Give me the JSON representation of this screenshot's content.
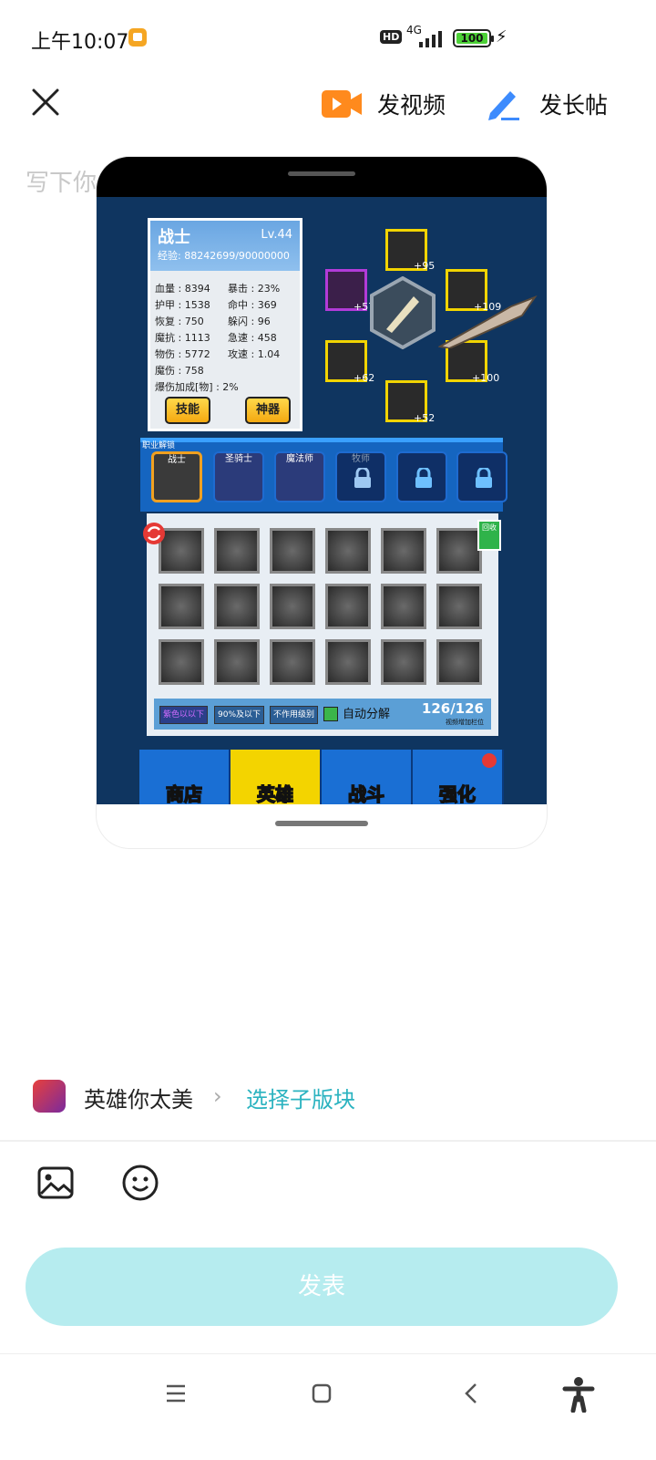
{
  "status": {
    "time": "上午10:07",
    "hd": "HD",
    "network": "4G",
    "battery": "100",
    "accent": "#f5a623"
  },
  "header": {
    "close_icon": "close-icon",
    "video_label": "发视频",
    "long_post_label": "发长帖",
    "video_color": "#ff8a1d",
    "pen_color": "#3d8bfd"
  },
  "editor": {
    "placeholder": "写下你"
  },
  "game": {
    "hero": {
      "name": "战士",
      "level": "Lv.44",
      "exp": "经验: 88242699/90000000"
    },
    "stats": [
      [
        "血量 : 8394",
        "暴击 : 23%"
      ],
      [
        "护甲 : 1538",
        "命中 : 369"
      ],
      [
        "恢复 : 750",
        "躲闪 : 96"
      ],
      [
        "魔抗 : 1113",
        "急速 : 458"
      ],
      [
        "物伤 : 5772",
        "攻速 : 1.04"
      ]
    ],
    "stat_magic": "魔伤 : 758",
    "stat_crit_bonus": "爆伤加成[物] : 2%",
    "skill_btn": "技能",
    "artifact_btn": "神器",
    "equip_bonus": [
      "+95",
      "+57",
      "+109",
      "+62",
      "+100",
      "+52"
    ],
    "class_title": "职业解锁",
    "classes": [
      "战士",
      "圣骑士",
      "魔法师",
      "牧师"
    ],
    "filters": {
      "quality": "紫色以以下",
      "percent": "90%及以下",
      "level": "不作用级别"
    },
    "auto_label": "自动分解",
    "bag_count": "126/126",
    "bag_sub": "视频增加栏位",
    "trash_label": "回收",
    "nav": [
      "商店",
      "英雄",
      "战斗",
      "强化"
    ]
  },
  "forum": {
    "name": "英雄你太美",
    "select_sub": "选择子版块"
  },
  "toolbar": {
    "image_icon": "image-icon",
    "emoji_icon": "emoji-icon"
  },
  "publish": {
    "label": "发表",
    "color": "#b6ecef"
  }
}
